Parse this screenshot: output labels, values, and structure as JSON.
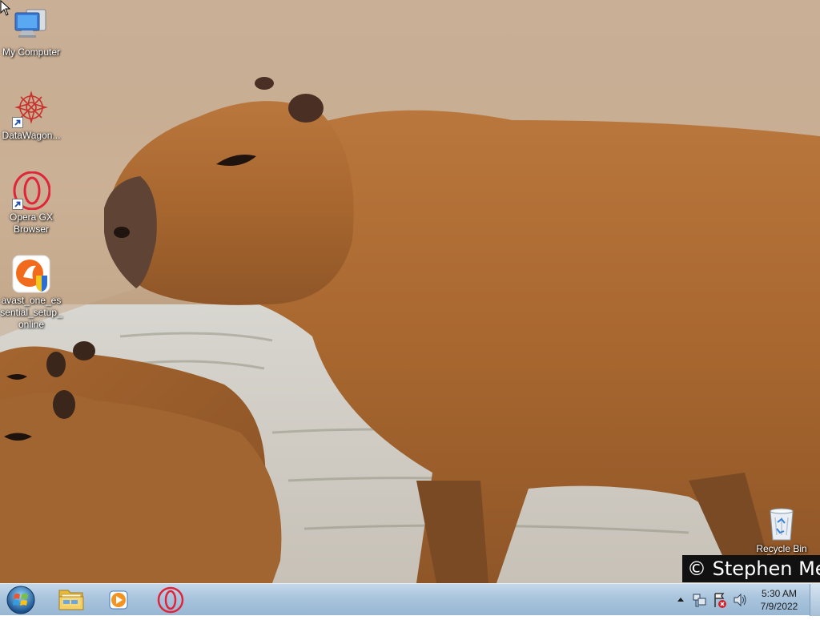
{
  "desktop": {
    "icons": [
      {
        "label": "My Computer",
        "icon": "computer-icon"
      },
      {
        "label": "DataWagon...",
        "icon": "datawagon-icon"
      },
      {
        "label": "Opera GX Browser",
        "icon": "opera-gx-icon"
      },
      {
        "label": "avast_one_essential_setup_online",
        "icon": "avast-icon"
      },
      {
        "label": "Recycle Bin",
        "icon": "recycle-bin-icon"
      }
    ],
    "wallpaper_credit": "© Stephen Me"
  },
  "taskbar": {
    "start": {
      "icon": "windows-start-icon"
    },
    "pinned": [
      {
        "name": "File Explorer",
        "icon": "folder-icon"
      },
      {
        "name": "Windows Media Player",
        "icon": "media-player-icon"
      },
      {
        "name": "Opera",
        "icon": "opera-icon"
      }
    ],
    "tray": {
      "icons": [
        "show-hidden-icons-icon",
        "network-icon",
        "action-center-icon",
        "volume-icon"
      ],
      "time": "5:30 AM",
      "date": "7/9/2022"
    }
  },
  "colors": {
    "taskbar": "#a9c4dd",
    "opera_red": "#e0243a",
    "avast_orange": "#f26a1b"
  }
}
